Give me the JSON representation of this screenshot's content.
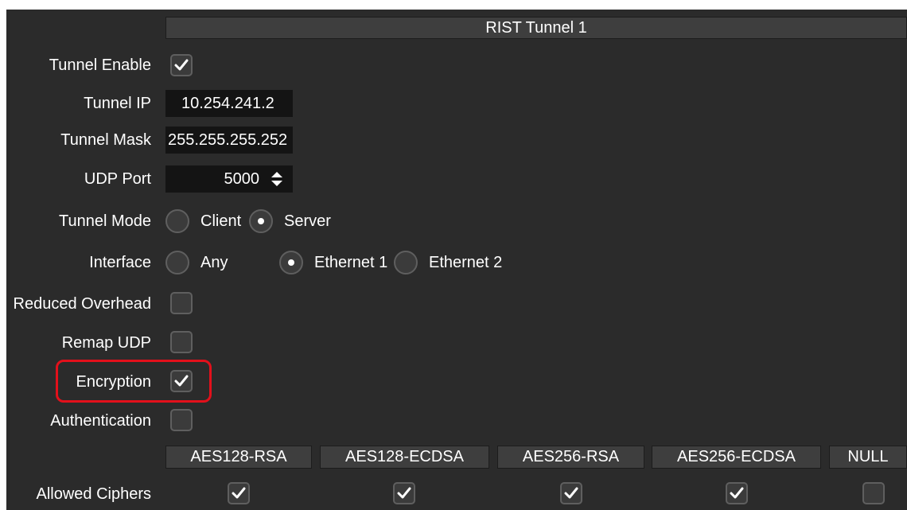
{
  "header": {
    "title": "RIST Tunnel 1"
  },
  "tunnel_enable": {
    "label": "Tunnel Enable",
    "checked": true
  },
  "tunnel_ip": {
    "label": "Tunnel IP",
    "value": "10.254.241.2"
  },
  "tunnel_mask": {
    "label": "Tunnel Mask",
    "value": "255.255.255.252"
  },
  "udp_port": {
    "label": "UDP Port",
    "value": "5000"
  },
  "tunnel_mode": {
    "label": "Tunnel Mode",
    "options": [
      "Client",
      "Server"
    ],
    "selected": "Server"
  },
  "interface": {
    "label": "Interface",
    "options": [
      "Any",
      "Ethernet 1",
      "Ethernet 2"
    ],
    "selected": "Ethernet 1"
  },
  "reduced_overhead": {
    "label": "Reduced Overhead",
    "checked": false
  },
  "remap_udp": {
    "label": "Remap UDP",
    "checked": false
  },
  "encryption": {
    "label": "Encryption",
    "checked": true
  },
  "authentication": {
    "label": "Authentication",
    "checked": false
  },
  "allowed_ciphers": {
    "label": "Allowed Ciphers",
    "columns": [
      {
        "name": "AES128-RSA",
        "checked": true
      },
      {
        "name": "AES128-ECDSA",
        "checked": true
      },
      {
        "name": "AES256-RSA",
        "checked": true
      },
      {
        "name": "AES256-ECDSA",
        "checked": true
      },
      {
        "name": "NULL",
        "checked": false
      }
    ]
  },
  "colors": {
    "panel_bg": "#2b2b2b",
    "header_bg": "#3e3e3e",
    "field_bg": "#141414",
    "highlight_border": "#e3101b"
  }
}
